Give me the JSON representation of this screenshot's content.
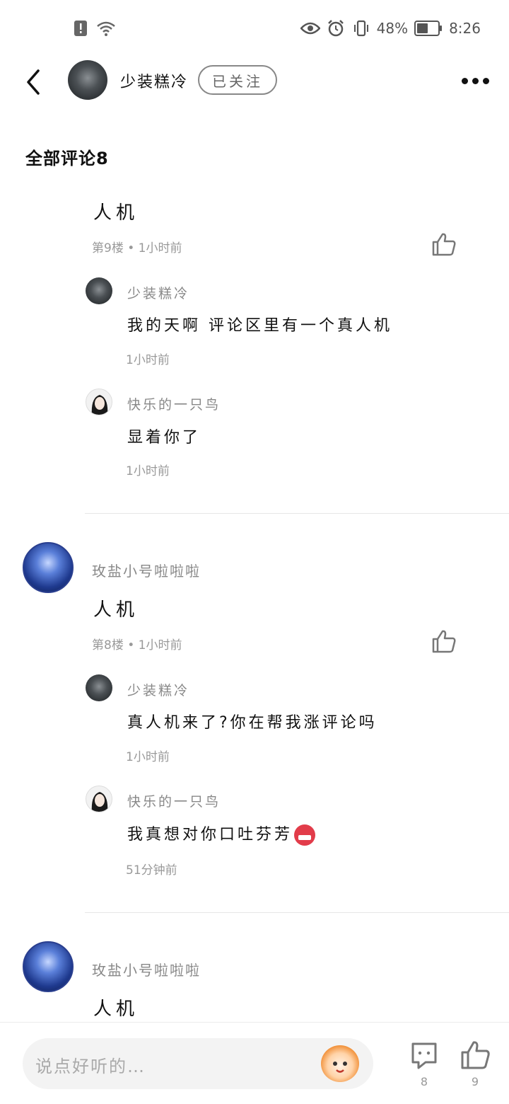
{
  "status_bar": {
    "battery_percent": "48%",
    "time": "8:26"
  },
  "header": {
    "username": "少装糕冷",
    "follow_label": "已关注"
  },
  "section_title": "全部评论8",
  "comments": [
    {
      "text": "人机",
      "meta": "第9楼 • 1小时前",
      "replies": [
        {
          "name": "少装糕冷",
          "text": "我的天啊 评论区里有一个真人机",
          "time": "1小时前"
        },
        {
          "name": "快乐的一只鸟",
          "text": "显着你了",
          "time": "1小时前"
        }
      ]
    },
    {
      "author": "玫盐小号啦啦啦",
      "text": "人机",
      "meta": "第8楼 • 1小时前",
      "replies": [
        {
          "name": "少装糕冷",
          "text": "真人机来了?你在帮我涨评论吗",
          "time": "1小时前"
        },
        {
          "name": "快乐的一只鸟",
          "text": "我真想对你口吐芬芳",
          "time": "51分钟前"
        }
      ]
    },
    {
      "author": "玫盐小号啦啦啦",
      "text": "人机"
    }
  ],
  "bottom_bar": {
    "input_placeholder": "说点好听的…",
    "comment_count": "8",
    "like_count": "9"
  },
  "colors": {
    "text_primary": "#111111",
    "text_secondary": "#888888",
    "input_bg": "#f3f3f3"
  }
}
